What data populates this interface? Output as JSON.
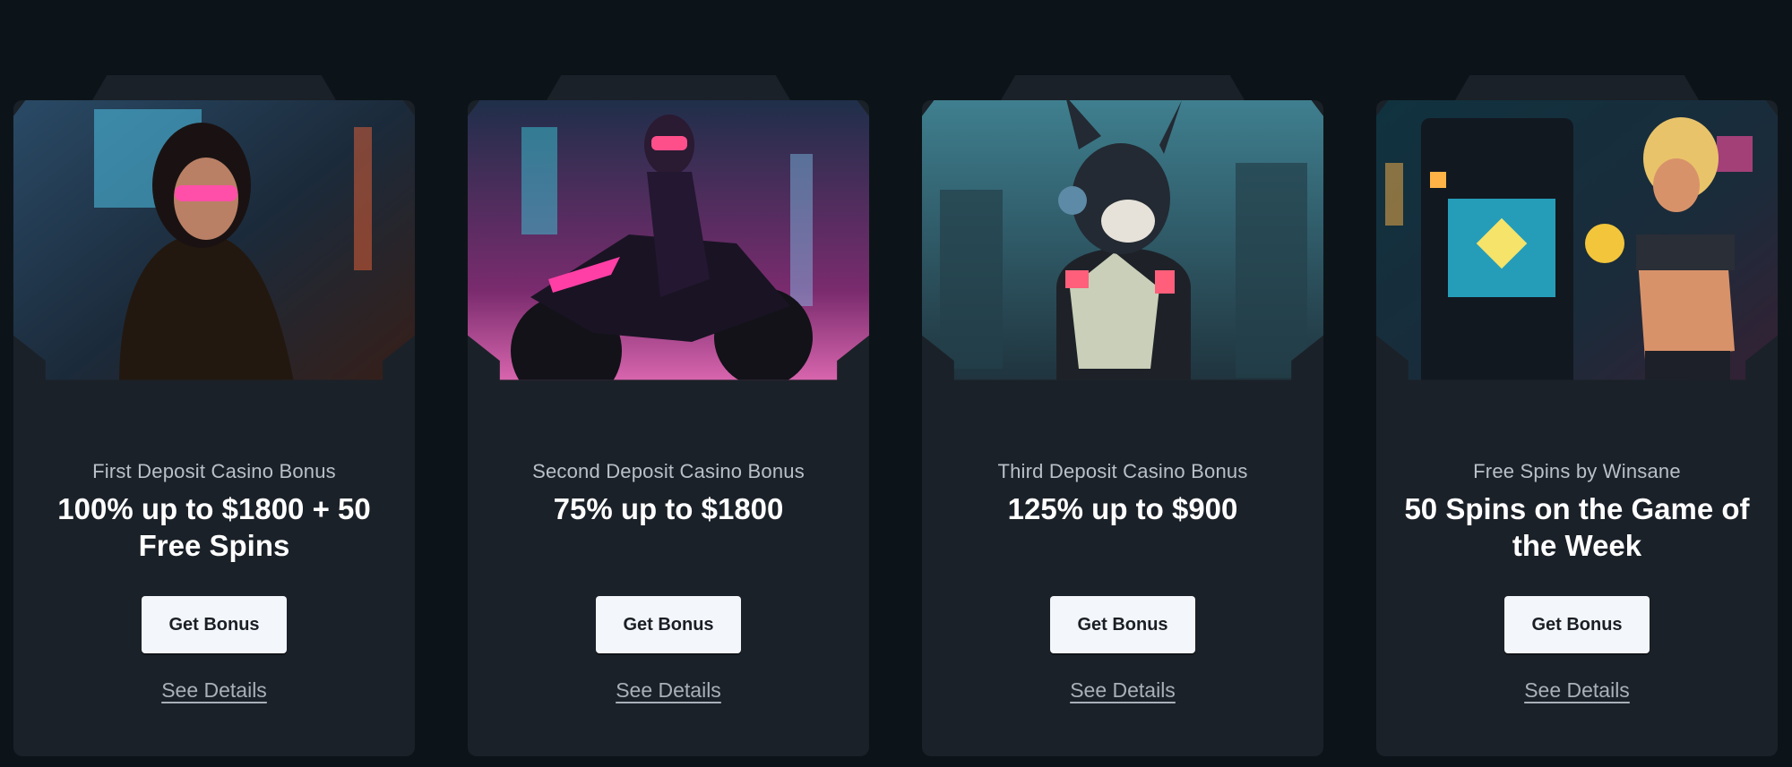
{
  "cards": [
    {
      "eyebrow": "First Deposit Casino Bonus",
      "headline": "100% up to $1800 + 50 Free Spins",
      "button_label": "Get Bonus",
      "details_label": "See Details",
      "image_subject": "cyberpunk woman in leather jacket with pink glasses"
    },
    {
      "eyebrow": "Second Deposit Casino Bonus",
      "headline": "75% up to $1800",
      "button_label": "Get Bonus",
      "details_label": "See Details",
      "image_subject": "rider on neon motorcycle"
    },
    {
      "eyebrow": "Third Deposit Casino Bonus",
      "headline": "125% up to $900",
      "button_label": "Get Bonus",
      "details_label": "See Details",
      "image_subject": "armored cyber dog with headphones"
    },
    {
      "eyebrow": "Free Spins by Winsane",
      "headline": "50 Spins on the Game of the Week",
      "button_label": "Get Bonus",
      "details_label": "See Details",
      "image_subject": "blonde woman beside slot machine holding gold coins"
    }
  ],
  "colors": {
    "page_bg": "#0d1419",
    "card_bg": "#1b2128",
    "button_bg": "#f3f6fb",
    "button_text": "#1a1f25",
    "headline": "#ffffff",
    "eyebrow": "#b9c0c8",
    "link": "#a9b0b8"
  }
}
